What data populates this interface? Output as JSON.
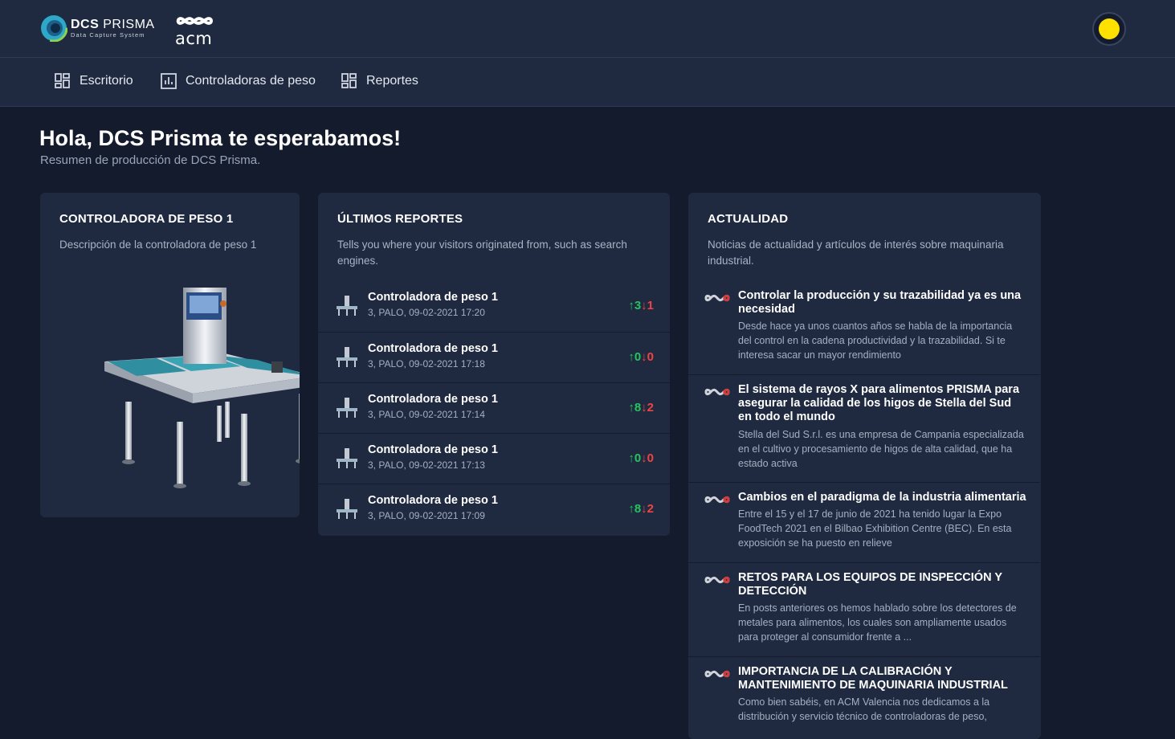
{
  "header": {
    "logo_brand_bold": "DCS",
    "logo_brand_light": "PRISMA",
    "logo_subtitle": "Data Capture System",
    "partner_logo": "acm",
    "avatar_color": "#ffe100"
  },
  "nav": {
    "items": [
      {
        "label": "Escritorio",
        "icon": "dashboard-icon"
      },
      {
        "label": "Controladoras de peso",
        "icon": "chart-icon"
      },
      {
        "label": "Reportes",
        "icon": "dashboard-icon"
      }
    ]
  },
  "greeting": {
    "title": "Hola, DCS Prisma te esperabamos!",
    "subtitle": "Resumen de producción de DCS Prisma."
  },
  "controller_card": {
    "title": "CONTROLADORA DE PESO 1",
    "description": "Descripción de la controladora de peso 1",
    "image": "checkweigher-machine"
  },
  "reports_card": {
    "title": "ÚLTIMOS REPORTES",
    "description": "Tells you where your visitors originated from, such as search engines.",
    "items": [
      {
        "title": "Controladora de peso 1",
        "subtitle": "3, PALO, 09-02-2021 17:20",
        "up": "3",
        "down": "1"
      },
      {
        "title": "Controladora de peso 1",
        "subtitle": "3, PALO, 09-02-2021 17:18",
        "up": "0",
        "down": "0"
      },
      {
        "title": "Controladora de peso 1",
        "subtitle": "3, PALO, 09-02-2021 17:14",
        "up": "8",
        "down": "2"
      },
      {
        "title": "Controladora de peso 1",
        "subtitle": "3, PALO, 09-02-2021 17:13",
        "up": "0",
        "down": "0"
      },
      {
        "title": "Controladora de peso 1",
        "subtitle": "3, PALO, 09-02-2021 17:09",
        "up": "8",
        "down": "2"
      }
    ]
  },
  "news_card": {
    "title": "ACTUALIDAD",
    "description": "Noticias de actualidad y artículos de interés sobre maquinaria industrial.",
    "items": [
      {
        "title": "Controlar la producción y su trazabilidad ya es una necesidad",
        "text": "Desde hace ya unos cuantos años se habla de la importancia del control en la cadena productividad y la trazabilidad. Si te interesa sacar un mayor rendimiento"
      },
      {
        "title": "El sistema de rayos X para alimentos PRISMA para asegurar la calidad de los higos de Stella del Sud en todo el mundo",
        "text": "Stella del Sud S.r.l. es una empresa de Campania especializada en el cultivo y procesamiento de higos de alta calidad, que ha estado activa"
      },
      {
        "title": "Cambios en el paradigma de la industria alimentaria",
        "text": "Entre el 15 y el 17 de junio de 2021 ha tenido lugar la Expo FoodTech 2021 en el Bilbao Exhibition Centre (BEC). En esta exposición se ha puesto en relieve"
      },
      {
        "title": "RETOS PARA LOS EQUIPOS DE INSPECCIÓN Y DETECCIÓN",
        "text": "En posts anteriores os hemos hablado sobre los detectores de metales para alimentos, los cuales son ampliamente usados para proteger al consumidor frente a ..."
      },
      {
        "title": "IMPORTANCIA DE LA CALIBRACIÓN Y MANTENIMIENTO DE MAQUINARIA INDUSTRIAL",
        "text": "Como bien sabéis, en ACM Valencia nos dedicamos a la distribución y servicio técnico de controladoras de peso,"
      }
    ]
  }
}
